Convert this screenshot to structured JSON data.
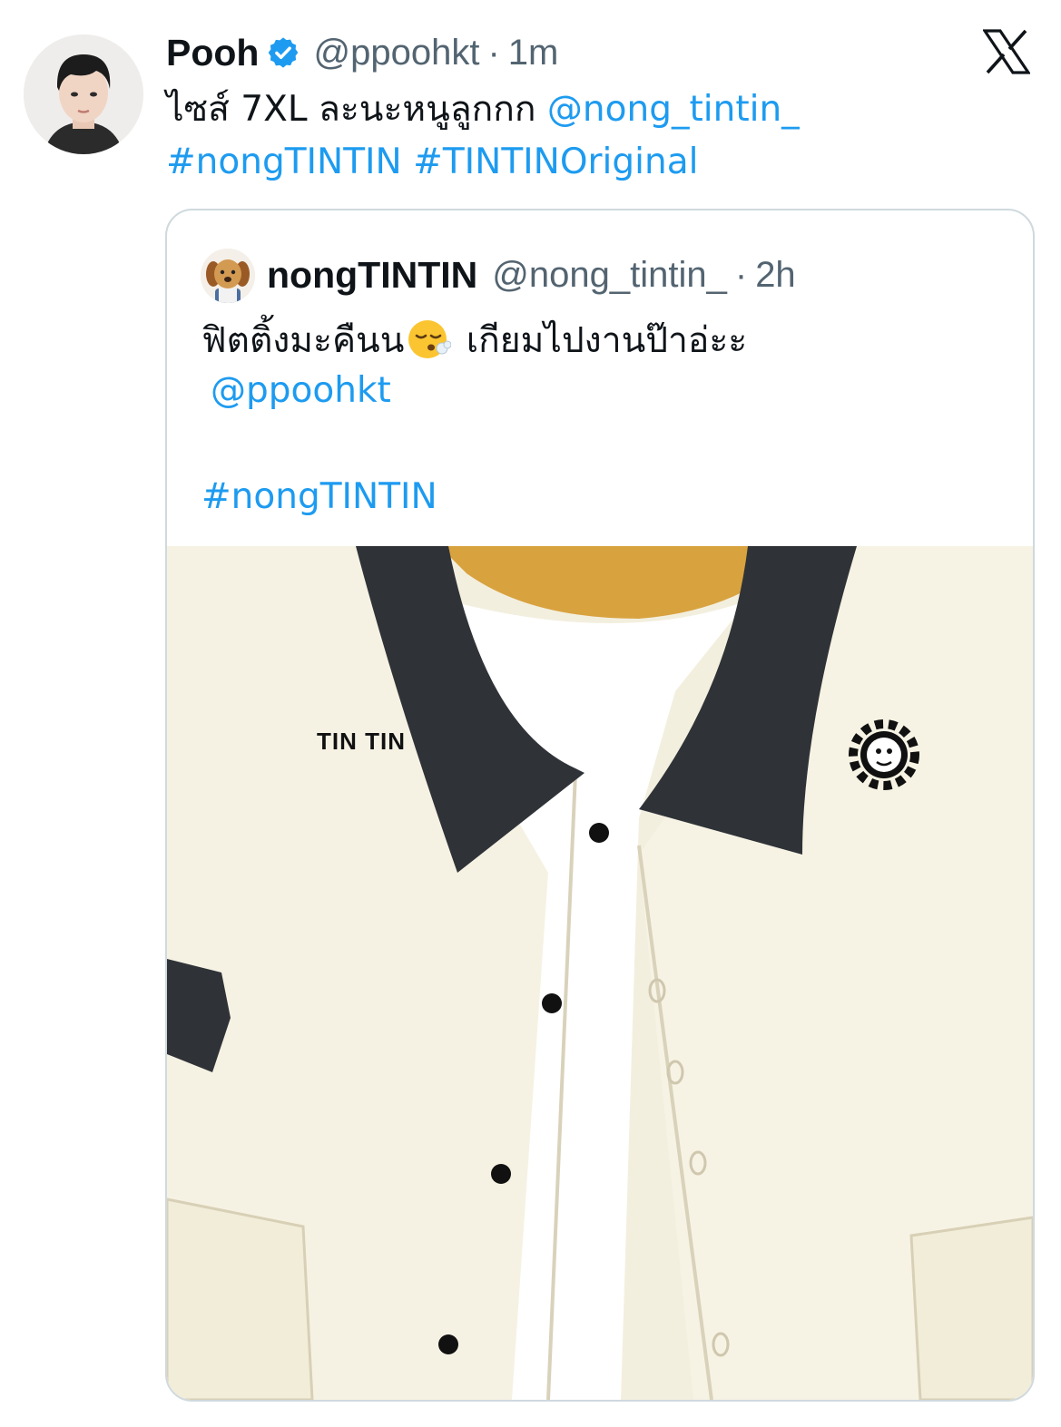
{
  "tweet": {
    "author_name": "Pooh",
    "handle": "@ppoohkt",
    "separator": "·",
    "time": "1m",
    "text_main": "ไซส์ 7XL ละนะหนูลูกกก",
    "mention": "@nong_tintin_",
    "hashtag1": "#nongTINTIN",
    "hashtag2": "#TINTINOriginal",
    "verified_icon": "verified-badge-icon",
    "brand_icon": "x-logo-icon"
  },
  "quoted": {
    "author_name": "nongTINTIN",
    "handle": "@nong_tintin_",
    "separator": "·",
    "time": "2h",
    "text_part1": "ฟิตติ้งมะคืนน",
    "emoji": "face-exhaling-emoji",
    "text_part2": "เกียมไปงานป๊าอ่ะะ",
    "mention": "@ppoohkt",
    "hashtag": "#nongTINTIN",
    "shirt_embroidery": "TIN TIN"
  },
  "colors": {
    "link": "#1d9bf0",
    "secondary_text": "#536471",
    "border": "#cfd9de",
    "shirt": "#f4f0df",
    "collar": "#2f3338"
  }
}
